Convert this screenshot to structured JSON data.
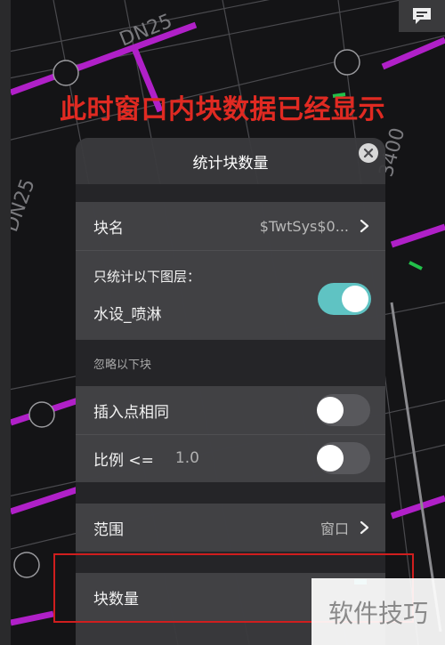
{
  "caption": "此时窗口内块数据已经显示",
  "drawing_labels": {
    "pipe_dn25_top": "DN25",
    "pipe_dn25_left": "DN25",
    "dim_3400": "3400"
  },
  "panel": {
    "title": "统计块数量",
    "block_name": {
      "label": "块名",
      "value": "$TwtSys$0..."
    },
    "layer_filter": {
      "caption": "只统计以下图层：",
      "layer": "水设_喷淋",
      "enabled": true
    },
    "ignore_section": {
      "heading": "忽略以下块",
      "same_insert_point": {
        "label": "插入点相同",
        "enabled": false
      },
      "scale": {
        "label": "比例 <=",
        "value": "1.0",
        "enabled": false
      }
    },
    "range": {
      "label": "范围",
      "value": "窗口"
    },
    "block_count": {
      "label": "块数量"
    }
  },
  "watermark": "软件技巧",
  "colors": {
    "accent_toggle": "#5fc3c3",
    "caption_red": "#e02a22",
    "highlight_red": "#d01e1e",
    "pipe_magenta": "#b020c8"
  },
  "icons": {
    "chat": "chat-icon",
    "close": "close-icon",
    "chevron": "chevron-right-icon"
  }
}
